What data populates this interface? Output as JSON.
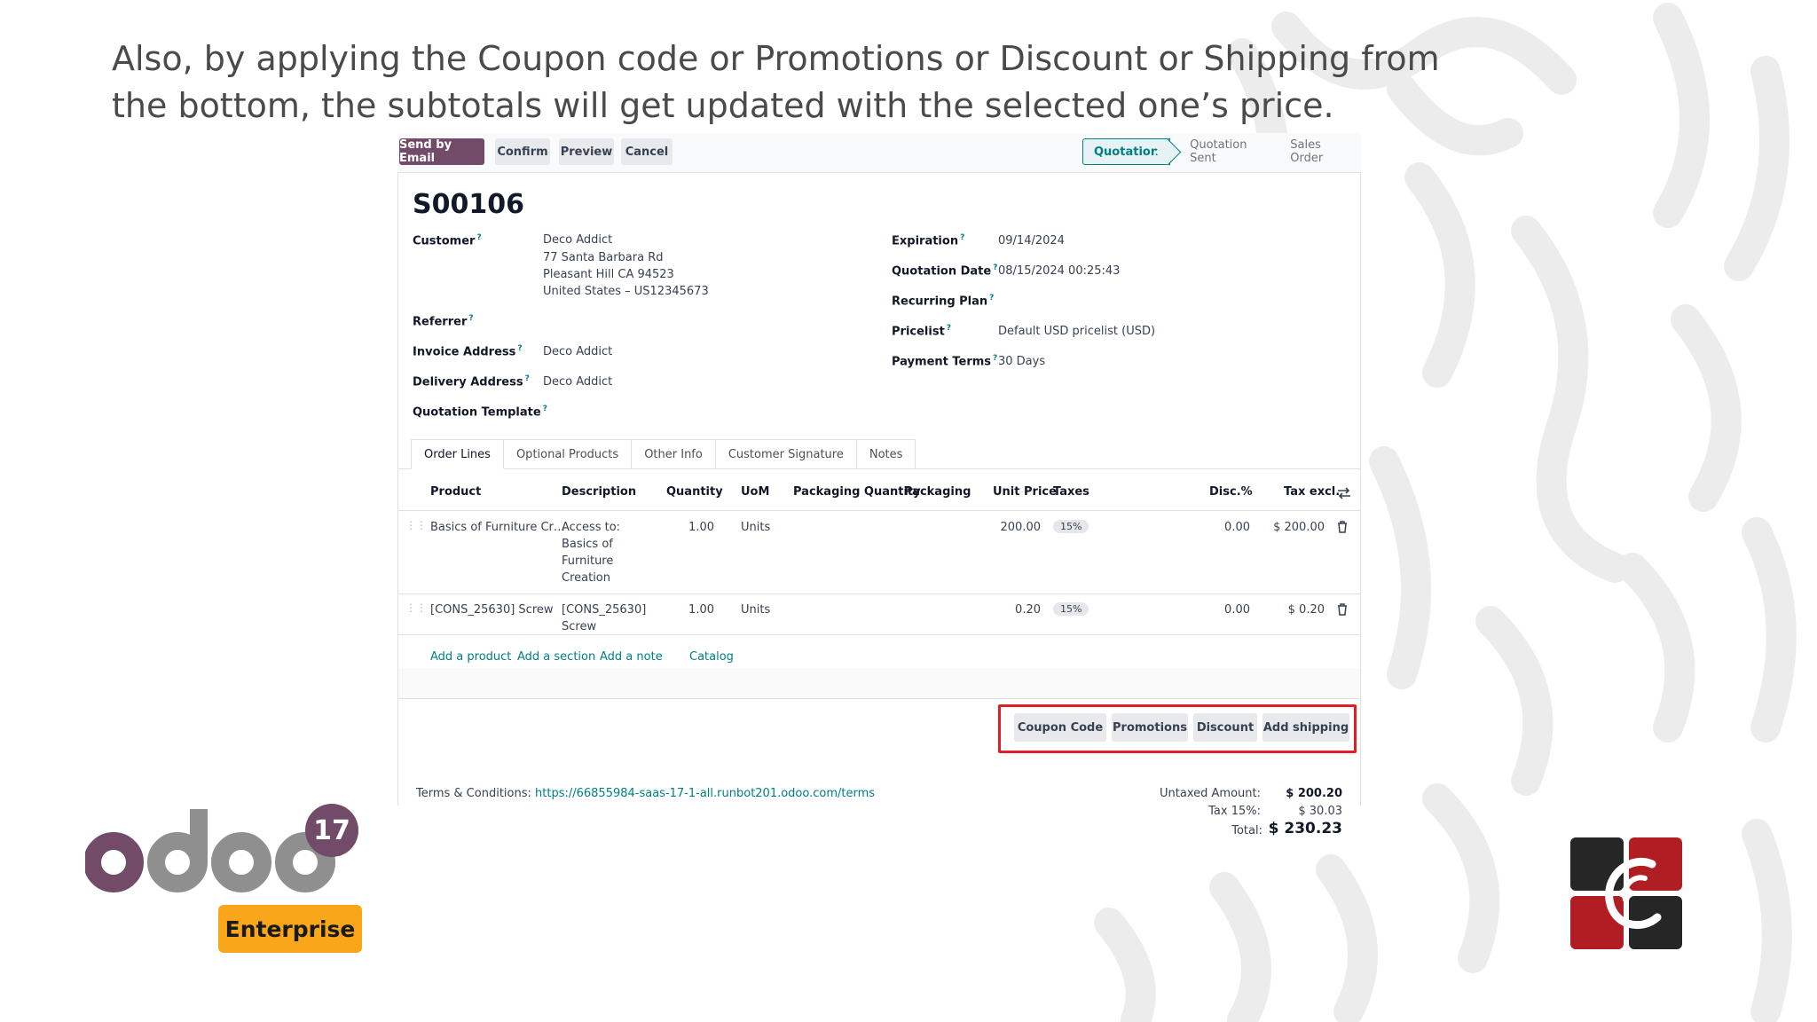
{
  "headline": "Also, by applying the Coupon code or Promotions or Discount or Shipping from the bottom, the subtotals will get updated with the selected one’s price.",
  "toolbar": {
    "send_by_email": "Send by Email",
    "confirm": "Confirm",
    "preview": "Preview",
    "cancel": "Cancel"
  },
  "status": {
    "quotation": "Quotation",
    "quotation_sent": "Quotation Sent",
    "sales_order": "Sales Order"
  },
  "record": {
    "name": "S00106",
    "customer_label": "Customer",
    "customer_lines": [
      "Deco Addict",
      "77 Santa Barbara Rd",
      "Pleasant Hill CA 94523",
      "United States – US12345673"
    ],
    "referrer_label": "Referrer",
    "invoice_address_label": "Invoice Address",
    "invoice_address": "Deco Addict",
    "delivery_address_label": "Delivery Address",
    "delivery_address": "Deco Addict",
    "quotation_template_label": "Quotation Template",
    "expiration_label": "Expiration",
    "expiration": "09/14/2024",
    "quotation_date_label": "Quotation Date",
    "quotation_date": "08/15/2024 00:25:43",
    "recurring_plan_label": "Recurring Plan",
    "pricelist_label": "Pricelist",
    "pricelist": "Default USD pricelist (USD)",
    "payment_terms_label": "Payment Terms",
    "payment_terms": "30 Days"
  },
  "tabs": [
    "Order Lines",
    "Optional Products",
    "Other Info",
    "Customer Signature",
    "Notes"
  ],
  "columns": {
    "product": "Product",
    "description": "Description",
    "quantity": "Quantity",
    "uom": "UoM",
    "packaging_quantity": "Packaging Quantity",
    "packaging": "Packaging",
    "unit_price": "Unit Price",
    "taxes": "Taxes",
    "disc": "Disc.%",
    "tax_excl": "Tax excl."
  },
  "lines": [
    {
      "product": "Basics of Furniture Cr…",
      "description": [
        "Access to:",
        "Basics of",
        "Furniture",
        "Creation"
      ],
      "quantity": "1.00",
      "uom": "Units",
      "unit_price": "200.00",
      "tax": "15%",
      "disc": "0.00",
      "subtotal": "$ 200.00"
    },
    {
      "product": "[CONS_25630] Screw",
      "description": [
        "[CONS_25630]",
        "Screw"
      ],
      "quantity": "1.00",
      "uom": "Units",
      "unit_price": "0.20",
      "tax": "15%",
      "disc": "0.00",
      "subtotal": "$ 0.20"
    }
  ],
  "add_links": {
    "add_product": "Add a product",
    "add_section": "Add a section",
    "add_note": "Add a note",
    "catalog": "Catalog"
  },
  "promo_buttons": {
    "coupon_code": "Coupon Code",
    "promotions": "Promotions",
    "discount": "Discount",
    "add_shipping": "Add shipping"
  },
  "terms": {
    "label": "Terms & Conditions:",
    "url": "https://66855984-saas-17-1-all.runbot201.odoo.com/terms"
  },
  "totals": {
    "untaxed_label": "Untaxed Amount:",
    "untaxed": "$ 200.20",
    "tax_label": "Tax 15%:",
    "tax": "$ 30.03",
    "total_label": "Total:",
    "total": "$ 230.23"
  },
  "branding": {
    "odoo_version": "17",
    "edition": "Enterprise"
  },
  "colors": {
    "odoo_purple": "#714b67",
    "odoo_teal": "#017e84",
    "highlight_red": "#e11d28",
    "enterprise_orange": "#f9a61b"
  }
}
